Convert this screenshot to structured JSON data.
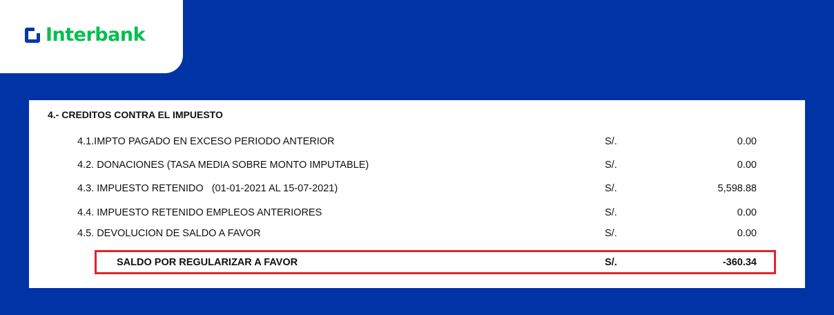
{
  "brand": {
    "name": "Interbank"
  },
  "section": {
    "title": "4.- CREDITOS CONTRA EL IMPUESTO"
  },
  "rows": [
    {
      "label": "4.1.IMPTO PAGADO EN EXCESO PERIODO ANTERIOR",
      "currency": "S/.",
      "amount": "0.00"
    },
    {
      "label": "4.2. DONACIONES (TASA MEDIA SOBRE MONTO IMPUTABLE)",
      "currency": "S/.",
      "amount": "0.00"
    },
    {
      "label": "4.3. IMPUESTO RETENIDO   (01-01-2021 AL 15-07-2021)",
      "currency": "S/.",
      "amount": "5,598.88"
    },
    {
      "label": "4.4. IMPUESTO RETENIDO EMPLEOS ANTERIORES",
      "currency": "S/.",
      "amount": "0.00"
    },
    {
      "label": "4.5. DEVOLUCION DE SALDO A FAVOR",
      "currency": "S/.",
      "amount": "0.00"
    }
  ],
  "total": {
    "label": "SALDO POR REGULARIZAR A FAVOR",
    "currency": "S/.",
    "amount": "-360.34"
  },
  "colors": {
    "background": "#0033a6",
    "brand_green": "#05be50",
    "highlight": "#e0242b"
  }
}
